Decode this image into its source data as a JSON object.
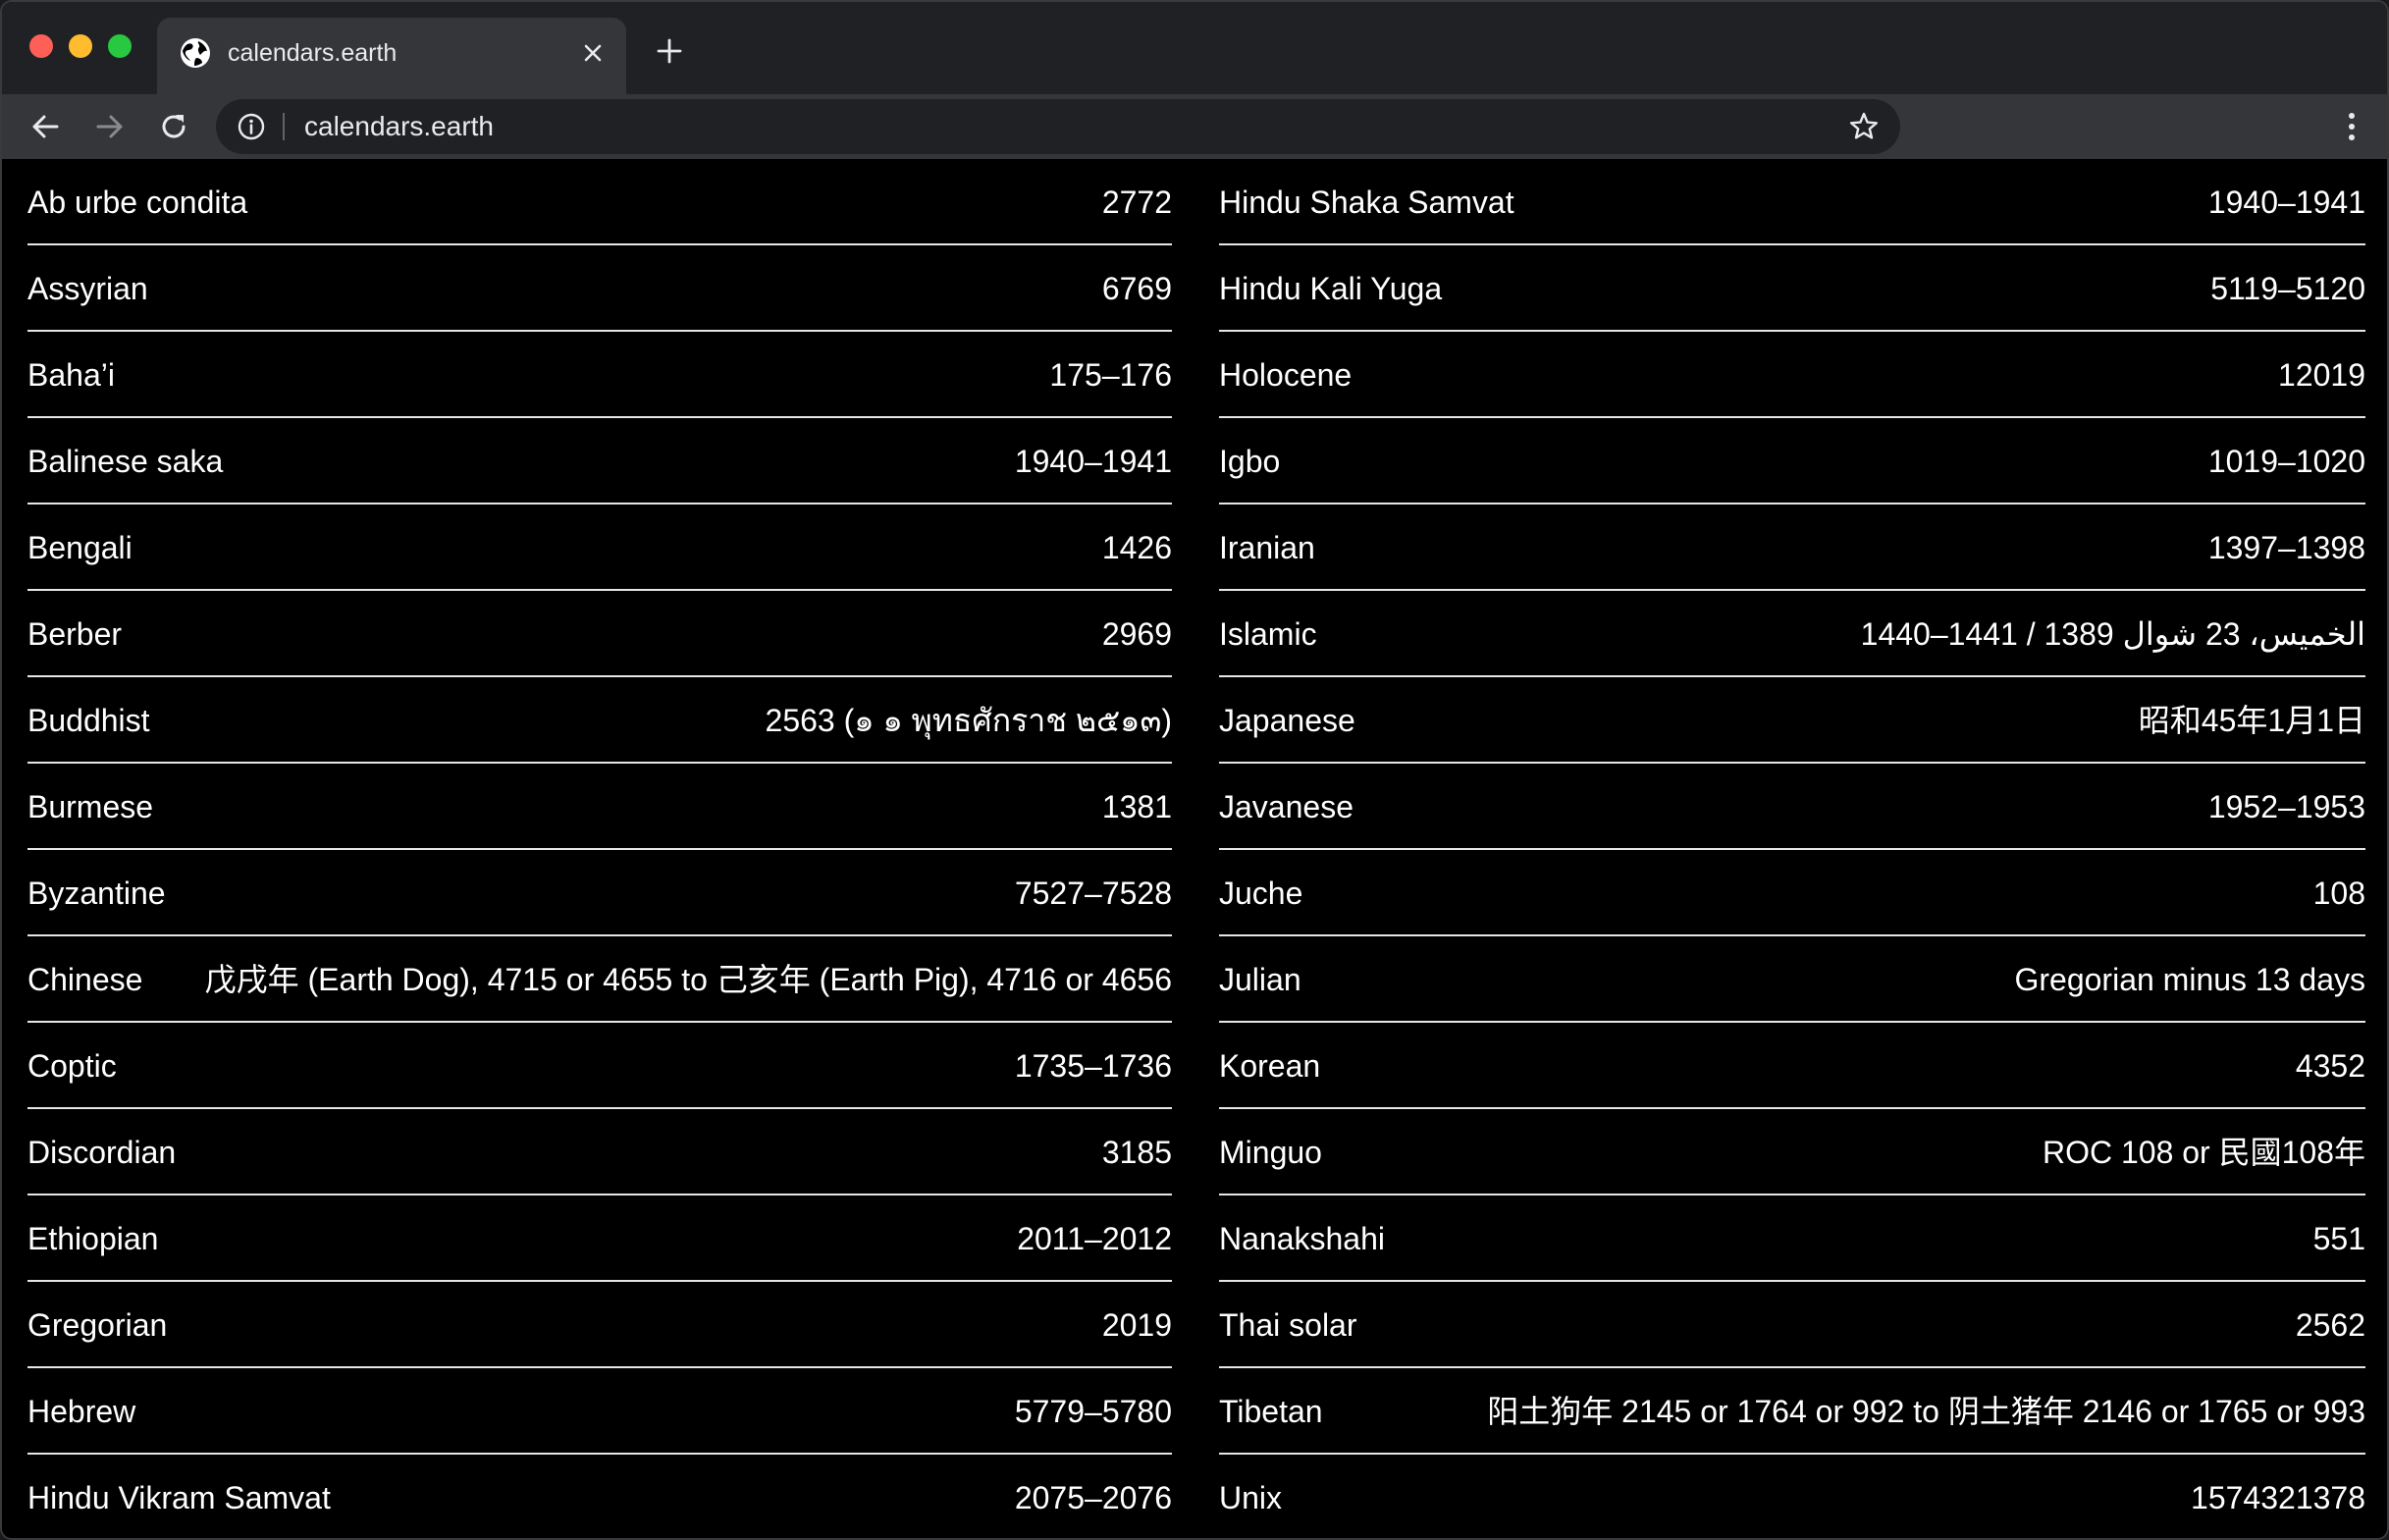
{
  "browser": {
    "tab_title": "calendars.earth",
    "url": "calendars.earth"
  },
  "calendars_left": [
    {
      "name": "Ab urbe condita",
      "value": "2772"
    },
    {
      "name": "Assyrian",
      "value": "6769"
    },
    {
      "name": "Baha’i",
      "value": "175–176"
    },
    {
      "name": "Balinese saka",
      "value": "1940–1941"
    },
    {
      "name": "Bengali",
      "value": "1426"
    },
    {
      "name": "Berber",
      "value": "2969"
    },
    {
      "name": "Buddhist",
      "value": "2563 (๑ ๑ พุทธศักราช ๒๕๑๓)"
    },
    {
      "name": "Burmese",
      "value": "1381"
    },
    {
      "name": "Byzantine",
      "value": "7527–7528"
    },
    {
      "name": "Chinese",
      "value": "戊戌年 (Earth Dog), 4715 or 4655 to 己亥年 (Earth Pig), 4716 or 4656"
    },
    {
      "name": "Coptic",
      "value": "1735–1736"
    },
    {
      "name": "Discordian",
      "value": "3185"
    },
    {
      "name": "Ethiopian",
      "value": "2011–2012"
    },
    {
      "name": "Gregorian",
      "value": "2019"
    },
    {
      "name": "Hebrew",
      "value": "5779–5780"
    },
    {
      "name": "Hindu Vikram Samvat",
      "value": "2075–2076"
    }
  ],
  "calendars_right": [
    {
      "name": "Hindu Shaka Samvat",
      "value": "1940–1941"
    },
    {
      "name": "Hindu Kali Yuga",
      "value": "5119–5120"
    },
    {
      "name": "Holocene",
      "value": "12019"
    },
    {
      "name": "Igbo",
      "value": "1019–1020"
    },
    {
      "name": "Iranian",
      "value": "1397–1398"
    },
    {
      "name": "Islamic",
      "value": "1440–1441 / 1389 الخميس، 23 شوال"
    },
    {
      "name": "Japanese",
      "value": "昭和45年1月1日"
    },
    {
      "name": "Javanese",
      "value": "1952–1953"
    },
    {
      "name": "Juche",
      "value": "108"
    },
    {
      "name": "Julian",
      "value": "Gregorian minus 13 days"
    },
    {
      "name": "Korean",
      "value": "4352"
    },
    {
      "name": "Minguo",
      "value": "ROC 108 or 民國108年"
    },
    {
      "name": "Nanakshahi",
      "value": "551"
    },
    {
      "name": "Thai solar",
      "value": "2562"
    },
    {
      "name": "Tibetan",
      "value": "阳土狗年 2145 or 1764 or 992 to 阴土猪年 2146 or 1765 or 993"
    },
    {
      "name": "Unix",
      "value": "1574321378"
    }
  ]
}
